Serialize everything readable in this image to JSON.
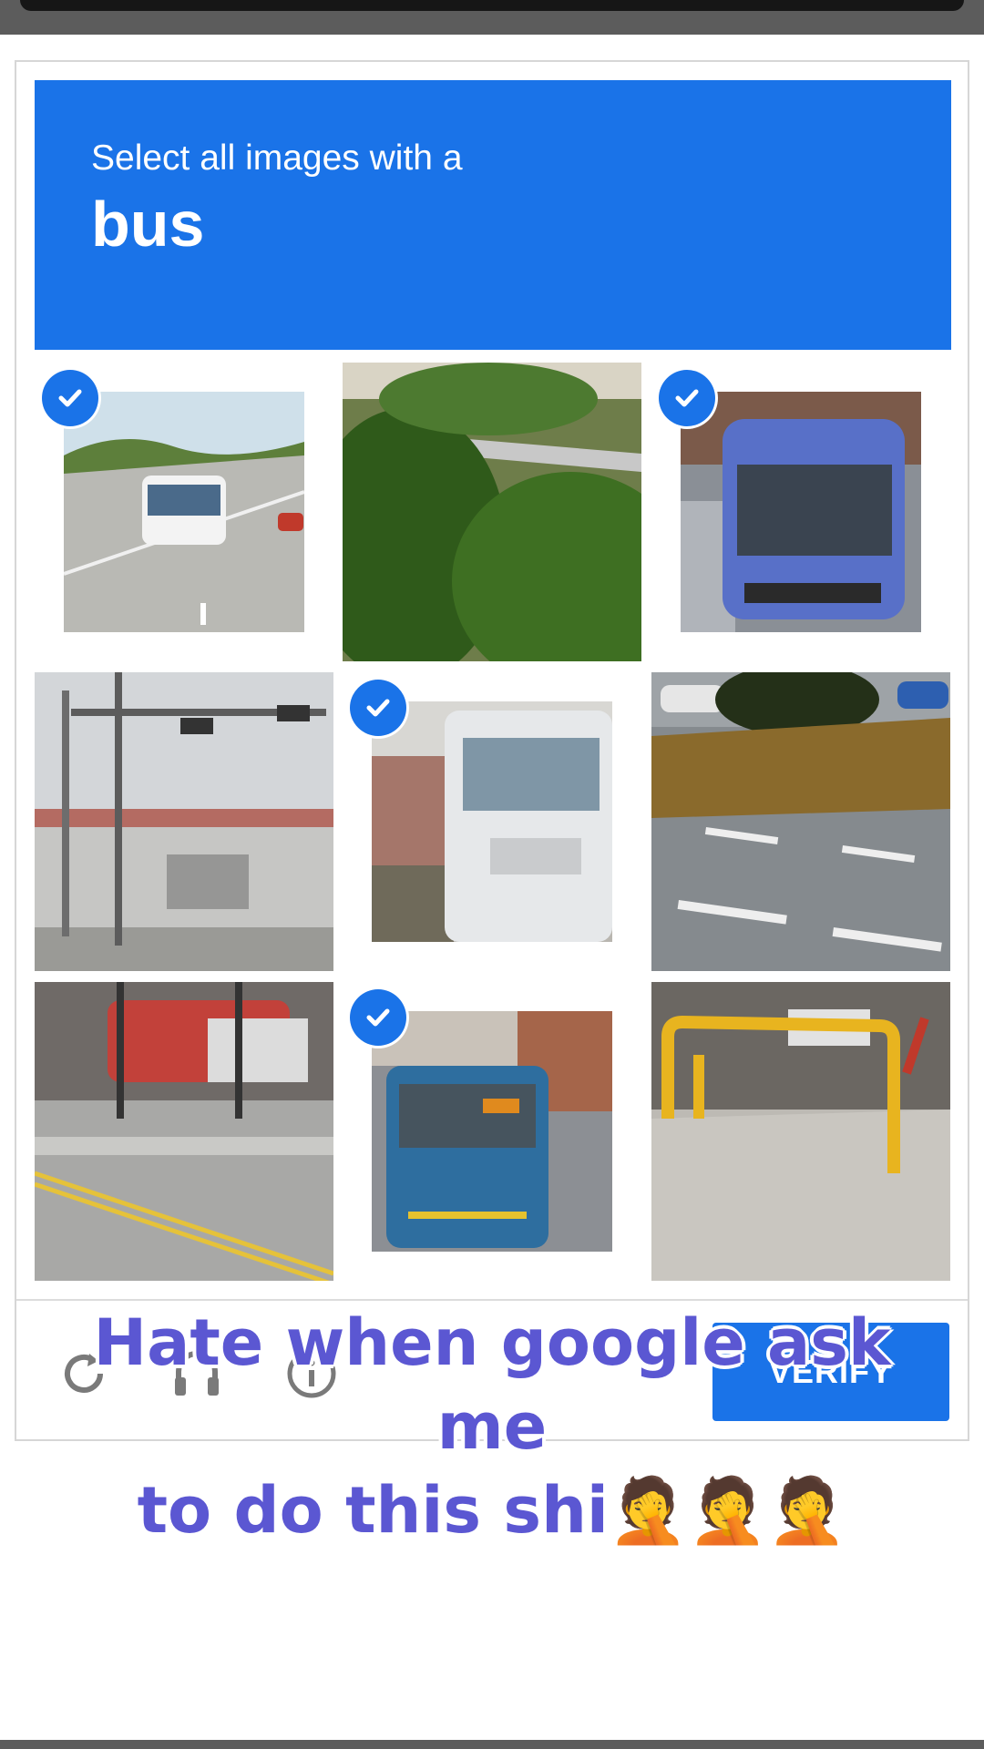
{
  "captcha": {
    "instruction": "Select all images with a",
    "target": "bus",
    "verify_label": "VERIFY",
    "tiles": [
      {
        "label": "Street scene with white bus",
        "selected": true
      },
      {
        "label": "Bushes and guardrail",
        "selected": false
      },
      {
        "label": "Front of blue bus",
        "selected": true
      },
      {
        "label": "Traffic light and fence",
        "selected": false
      },
      {
        "label": "White truck cab",
        "selected": true
      },
      {
        "label": "Road with tree",
        "selected": false
      },
      {
        "label": "Road with parked cars",
        "selected": false
      },
      {
        "label": "Rear of blue bus",
        "selected": true
      },
      {
        "label": "Yellow railing",
        "selected": false
      }
    ],
    "icons": [
      "reload-icon",
      "headphones-icon",
      "info-icon",
      "check-icon"
    ],
    "colors": {
      "accent": "#1a73e8",
      "caption": "#5b57d2"
    }
  },
  "caption": {
    "line1": "Hate when google ask me",
    "line2": "to do this shi",
    "emoji": "🤦🤦🤦"
  }
}
